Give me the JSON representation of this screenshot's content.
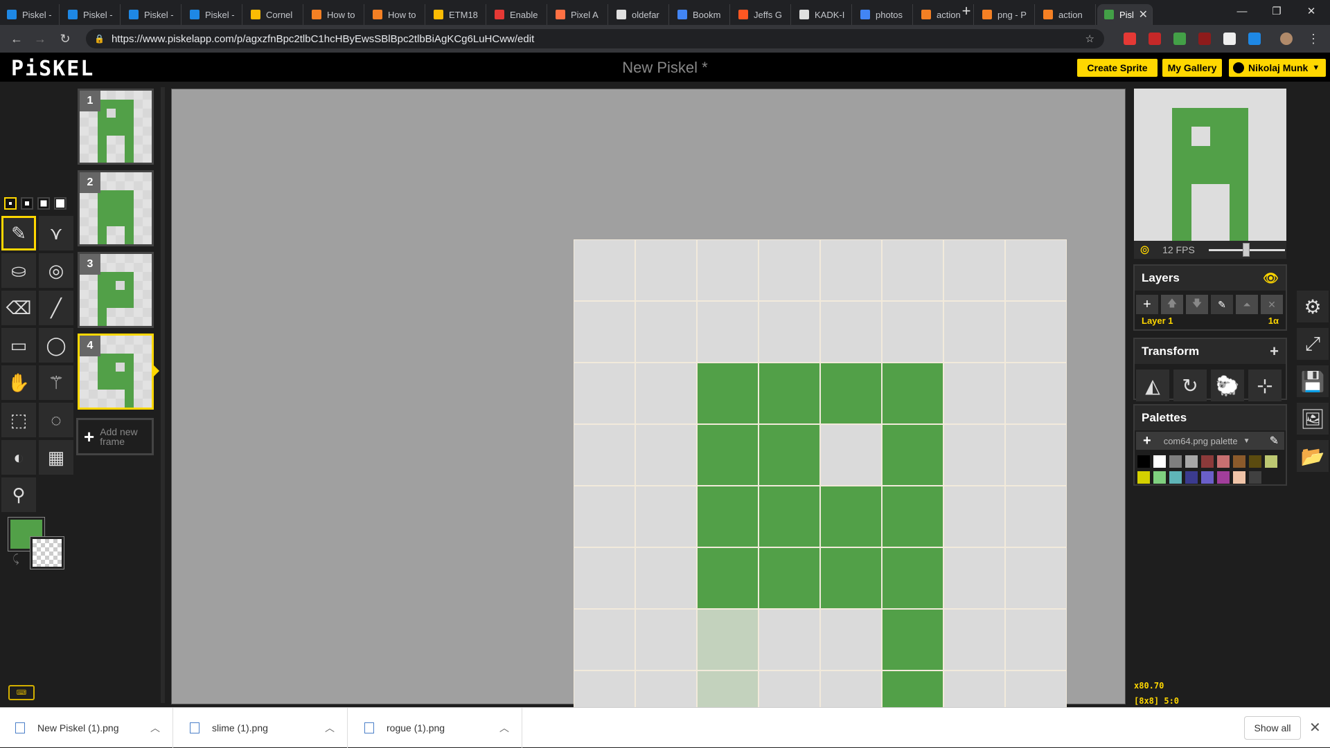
{
  "browser": {
    "tabs": [
      {
        "title": "Piskel -",
        "color": "#1e88e5"
      },
      {
        "title": "Piskel -",
        "color": "#1e88e5"
      },
      {
        "title": "Piskel -",
        "color": "#1e88e5"
      },
      {
        "title": "Piskel -",
        "color": "#1e88e5"
      },
      {
        "title": "Cornel",
        "color": "#fbbc04"
      },
      {
        "title": "How to",
        "color": "#f48024"
      },
      {
        "title": "How to",
        "color": "#f48024"
      },
      {
        "title": "ETM18",
        "color": "#fbbc04"
      },
      {
        "title": "Enable",
        "color": "#e53935"
      },
      {
        "title": "Pixel A",
        "color": "#ff7043"
      },
      {
        "title": "oldefar",
        "color": "#e0e0e0"
      },
      {
        "title": "Bookm",
        "color": "#4285f4"
      },
      {
        "title": "Jeffs G",
        "color": "#ff5722"
      },
      {
        "title": "KADK-I",
        "color": "#e0e0e0"
      },
      {
        "title": "photos",
        "color": "#4285f4"
      },
      {
        "title": "action",
        "color": "#f48024"
      },
      {
        "title": "png - P",
        "color": "#f48024"
      },
      {
        "title": "action",
        "color": "#f48024"
      },
      {
        "title": "Pisl",
        "color": "#43a047"
      }
    ],
    "url": "https://www.piskelapp.com/p/agxzfnBpc2tlbC1hcHByEwsSBlBpc2tlbBiAgKCg6LuHCww/edit",
    "new_tab": "+",
    "minimize": "—",
    "restore": "❐",
    "close": "✕"
  },
  "header": {
    "logo": "PiSKEL",
    "title": "New Piskel *",
    "create_sprite": "Create Sprite",
    "my_gallery": "My Gallery",
    "user": "Nikolaj Munk"
  },
  "frames": [
    {
      "number": "1",
      "pixels": [
        [
          1,
          2
        ],
        [
          1,
          3
        ],
        [
          1,
          4
        ],
        [
          1,
          5
        ],
        [
          2,
          2
        ],
        [
          2,
          4
        ],
        [
          2,
          5
        ],
        [
          3,
          2
        ],
        [
          3,
          3
        ],
        [
          3,
          4
        ],
        [
          3,
          5
        ],
        [
          4,
          2
        ],
        [
          4,
          3
        ],
        [
          4,
          4
        ],
        [
          4,
          5
        ],
        [
          5,
          2
        ],
        [
          5,
          5
        ],
        [
          6,
          2
        ],
        [
          6,
          5
        ],
        [
          7,
          2
        ],
        [
          7,
          5
        ]
      ]
    },
    {
      "number": "2",
      "pixels": [
        [
          2,
          2
        ],
        [
          2,
          3
        ],
        [
          2,
          4
        ],
        [
          2,
          5
        ],
        [
          3,
          2
        ],
        [
          3,
          3
        ],
        [
          3,
          4
        ],
        [
          3,
          5
        ],
        [
          4,
          2
        ],
        [
          4,
          3
        ],
        [
          4,
          4
        ],
        [
          4,
          5
        ],
        [
          5,
          2
        ],
        [
          5,
          3
        ],
        [
          5,
          4
        ],
        [
          5,
          5
        ],
        [
          6,
          2
        ],
        [
          6,
          5
        ],
        [
          7,
          2
        ],
        [
          7,
          5
        ]
      ]
    },
    {
      "number": "3",
      "pixels": [
        [
          2,
          2
        ],
        [
          2,
          3
        ],
        [
          2,
          4
        ],
        [
          2,
          5
        ],
        [
          3,
          2
        ],
        [
          3,
          3
        ],
        [
          3,
          5
        ],
        [
          4,
          2
        ],
        [
          4,
          3
        ],
        [
          4,
          4
        ],
        [
          4,
          5
        ],
        [
          5,
          2
        ],
        [
          5,
          3
        ],
        [
          5,
          4
        ],
        [
          5,
          5
        ],
        [
          6,
          2
        ],
        [
          7,
          2
        ]
      ]
    },
    {
      "number": "4",
      "pixels": [
        [
          2,
          2
        ],
        [
          2,
          3
        ],
        [
          2,
          4
        ],
        [
          2,
          5
        ],
        [
          3,
          2
        ],
        [
          3,
          3
        ],
        [
          3,
          5
        ],
        [
          4,
          2
        ],
        [
          4,
          3
        ],
        [
          4,
          4
        ],
        [
          4,
          5
        ],
        [
          5,
          2
        ],
        [
          5,
          3
        ],
        [
          5,
          4
        ],
        [
          5,
          5
        ],
        [
          6,
          5
        ],
        [
          7,
          5
        ]
      ]
    }
  ],
  "add_frame_label": "Add new frame",
  "canvas": {
    "pixels": [
      [
        2,
        2
      ],
      [
        2,
        3
      ],
      [
        2,
        4
      ],
      [
        2,
        5
      ],
      [
        3,
        2
      ],
      [
        3,
        3
      ],
      [
        3,
        5
      ],
      [
        4,
        2
      ],
      [
        4,
        3
      ],
      [
        4,
        4
      ],
      [
        4,
        5
      ],
      [
        5,
        2
      ],
      [
        5,
        3
      ],
      [
        5,
        4
      ],
      [
        5,
        5
      ],
      [
        6,
        5
      ],
      [
        7,
        5
      ]
    ],
    "onion": [
      [
        6,
        2
      ],
      [
        7,
        2
      ]
    ],
    "color": "#52a048",
    "onion_color": "#c3d2bd"
  },
  "preview": {
    "fps_label": "12 FPS",
    "fps": 12
  },
  "layers": {
    "title": "Layers",
    "layer_name": "Layer 1",
    "opacity": "1α"
  },
  "transform": {
    "title": "Transform"
  },
  "palettes": {
    "title": "Palettes",
    "selected": "com64.png palette",
    "colors": [
      "#000000",
      "#ffffff",
      "#7f7f7f",
      "#a8a8a8",
      "#8b3a3a",
      "#c77071",
      "#8b5a2b",
      "#5b4b0f",
      "#bdc872",
      "#d4d000",
      "#7fd07f",
      "#5fb5b8",
      "#3b3b8f",
      "#6a5fc9",
      "#a13e9b",
      "#f0c4a8",
      "#404040"
    ]
  },
  "colors": {
    "primary": "#52a048",
    "accent": "#ffd700"
  },
  "status": {
    "zoom": "x80.70",
    "size_position": "[8x8] 5:0"
  },
  "downloads": [
    {
      "name": "New Piskel (1).png"
    },
    {
      "name": "slime (1).png"
    },
    {
      "name": "rogue (1).png"
    }
  ],
  "show_all": "Show all"
}
